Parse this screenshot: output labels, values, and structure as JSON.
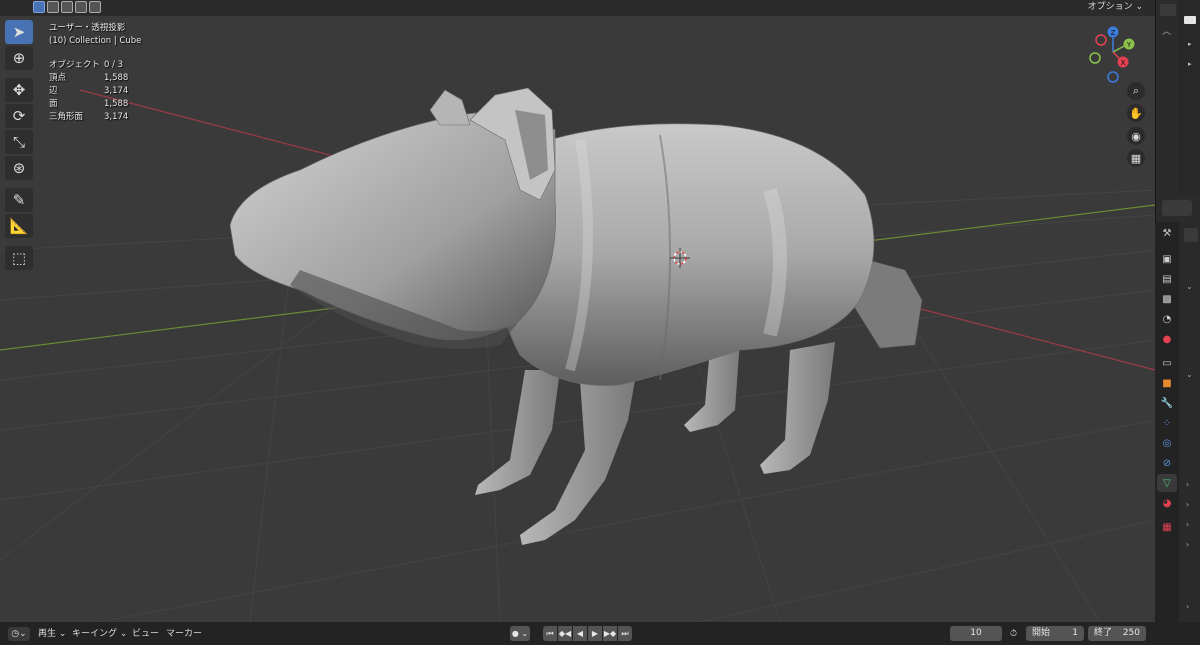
{
  "header": {
    "options_label": "オプション ⌄"
  },
  "overlay": {
    "view_name": "ユーザー・透視投影",
    "collection": "(10) Collection | Cube",
    "stats": [
      {
        "label": "オブジェクト",
        "value": "0 / 3"
      },
      {
        "label": "頂点",
        "value": "1,588"
      },
      {
        "label": "辺",
        "value": "3,174"
      },
      {
        "label": "面",
        "value": "1,588"
      },
      {
        "label": "三角形面",
        "value": "3,174"
      }
    ]
  },
  "gizmo": {
    "x": "X",
    "y": "Y",
    "z": "Z"
  },
  "timeline": {
    "playback": "再生",
    "keying": "キーイング",
    "view": "ビュー",
    "marker": "マーカー",
    "current_frame": "10",
    "start_label": "開始",
    "start_value": "1",
    "end_label": "終了",
    "end_value": "250"
  },
  "colors": {
    "active_tool": "#4772b3",
    "axis_x": "#e44152",
    "axis_y": "#8bc34a",
    "axis_z": "#3d7de0"
  }
}
